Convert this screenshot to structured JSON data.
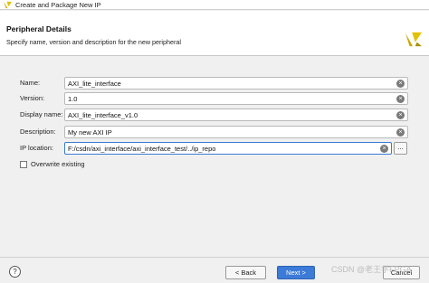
{
  "window": {
    "title": "Create and Package New IP"
  },
  "header": {
    "heading": "Peripheral Details",
    "subtitle": "Specify name, version and description for the new peripheral"
  },
  "fields": [
    {
      "label": "Name:",
      "value": "AXI_lite_interface"
    },
    {
      "label": "Version:",
      "value": "1.0"
    },
    {
      "label": "Display name:",
      "value": "AXI_lite_interface_v1.0"
    },
    {
      "label": "Description:",
      "value": "My new AXI IP"
    },
    {
      "label": "IP location:",
      "value": "F:/csdn/axi_interface/axi_interface_test/../ip_repo"
    }
  ],
  "browse_label": "...",
  "clear_glyph": "×",
  "overwrite": {
    "label": "Overwrite existing",
    "checked": false
  },
  "footer": {
    "help_label": "?",
    "back_label": "< Back",
    "next_label": "Next >",
    "cancel_label": "Cancel"
  },
  "watermark": "CSDN @老王学FPGA",
  "colors": {
    "accent": "#3d7bd8",
    "logo_yellow": "#d4b400"
  }
}
